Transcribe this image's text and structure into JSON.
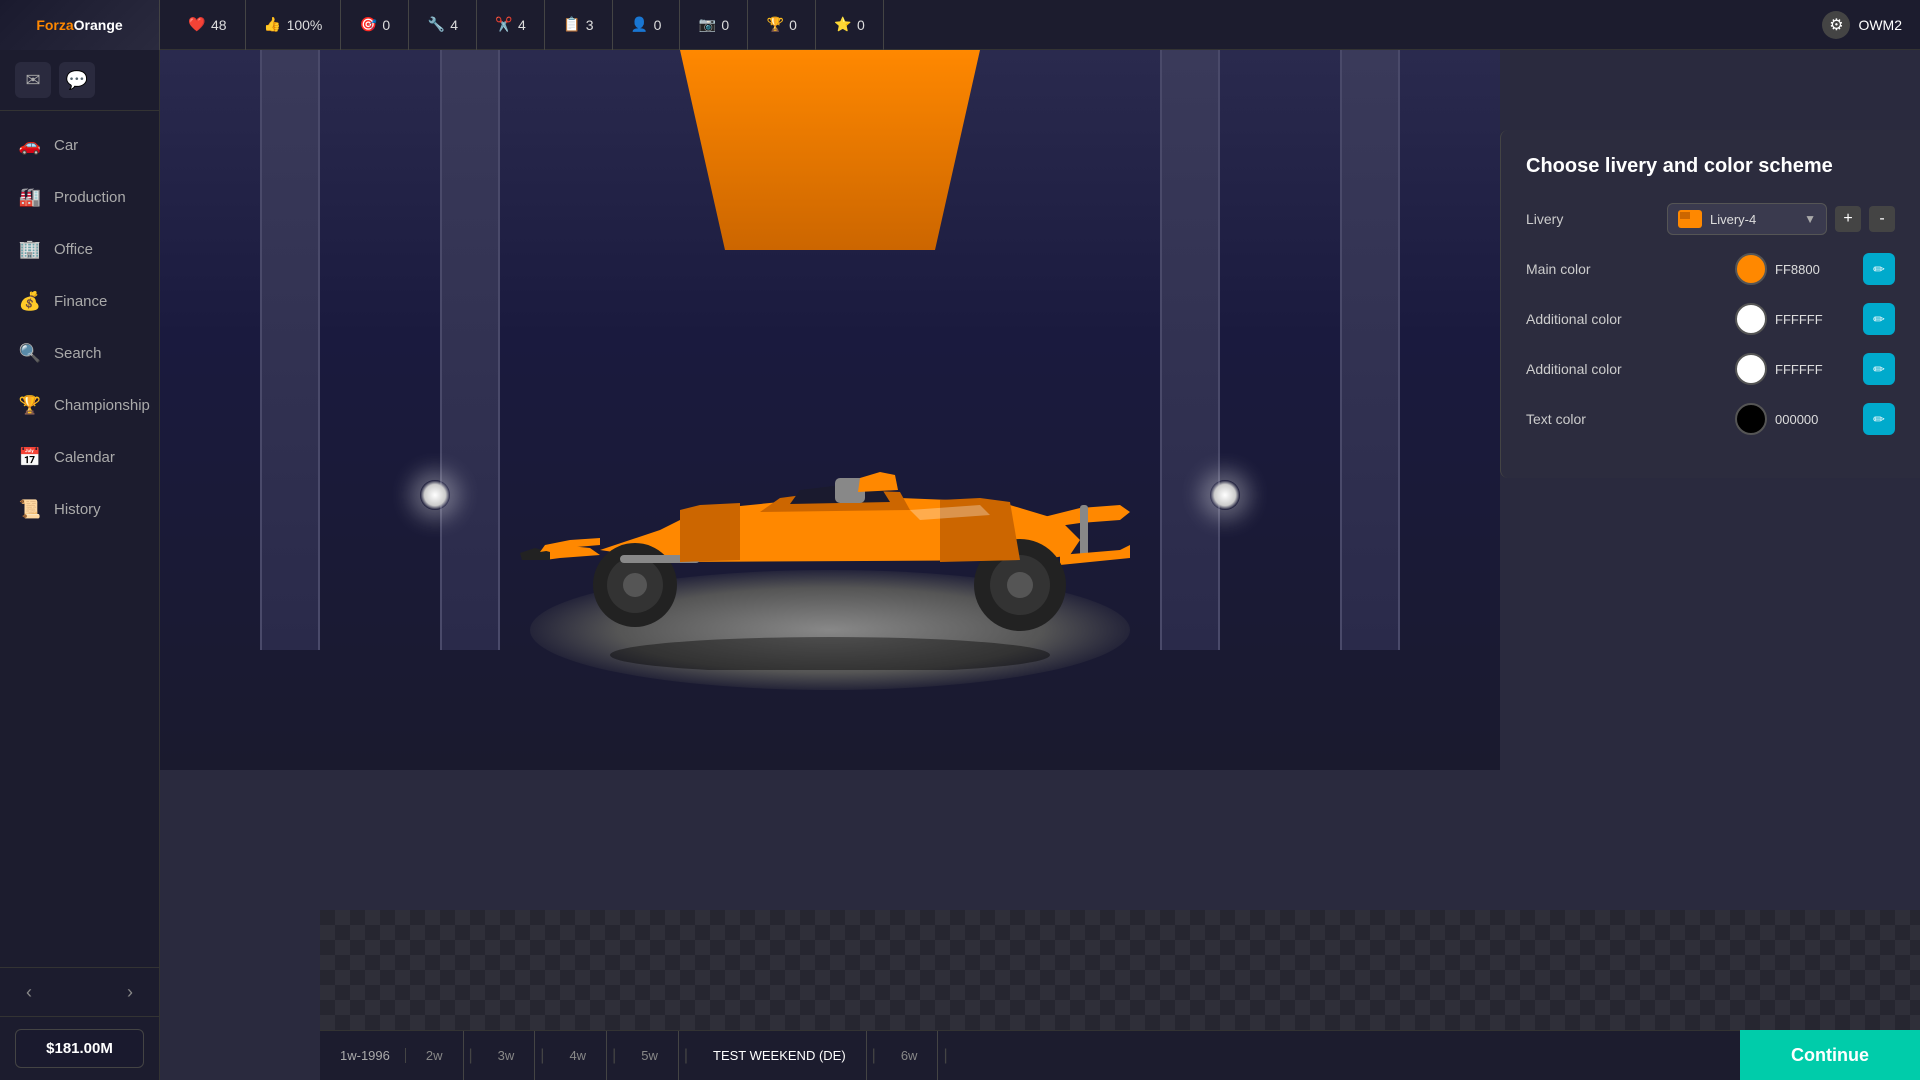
{
  "logo": {
    "part1": "Forza",
    "part2": "Orange"
  },
  "topbar": {
    "stats": [
      {
        "icon": "❤️",
        "iconClass": "red",
        "value": "48",
        "id": "health"
      },
      {
        "icon": "👍",
        "iconClass": "green",
        "value": "100%",
        "id": "approval"
      },
      {
        "icon": "🎯",
        "iconClass": "purple",
        "value": "0",
        "id": "sponsors"
      },
      {
        "icon": "🔧",
        "iconClass": "blue",
        "value": "4",
        "id": "mechanics"
      },
      {
        "icon": "✂️",
        "iconClass": "yellow",
        "value": "4",
        "id": "tools"
      },
      {
        "icon": "📋",
        "iconClass": "teal",
        "value": "3",
        "id": "tasks"
      },
      {
        "icon": "👤",
        "iconClass": "orange",
        "value": "0",
        "id": "staff"
      },
      {
        "icon": "📷",
        "iconClass": "blue",
        "value": "0",
        "id": "media"
      },
      {
        "icon": "🏆",
        "iconClass": "yellow",
        "value": "0",
        "id": "trophy"
      },
      {
        "icon": "⭐",
        "iconClass": "teal",
        "value": "0",
        "id": "stars"
      }
    ],
    "username": "OWM2"
  },
  "sidebar": {
    "notifications": [
      {
        "icon": "✉️",
        "label": "mail-button"
      },
      {
        "icon": "💬",
        "label": "chat-button"
      }
    ],
    "items": [
      {
        "icon": "🚗",
        "label": "Car",
        "id": "car",
        "active": false
      },
      {
        "icon": "🏭",
        "label": "Production",
        "id": "production",
        "active": false
      },
      {
        "icon": "🏢",
        "label": "Office",
        "id": "office",
        "active": false
      },
      {
        "icon": "💰",
        "label": "Finance",
        "id": "finance",
        "active": false
      },
      {
        "icon": "🔍",
        "label": "Search",
        "id": "search",
        "active": false
      },
      {
        "icon": "🏆",
        "label": "Championship",
        "id": "championship",
        "active": false
      },
      {
        "icon": "📅",
        "label": "Calendar",
        "id": "calendar",
        "active": false
      },
      {
        "icon": "📜",
        "label": "History",
        "id": "history",
        "active": false
      }
    ],
    "money": "$181.00M"
  },
  "panel": {
    "title": "Choose livery and color scheme",
    "livery_label": "Livery",
    "livery_value": "Livery-4",
    "colors": [
      {
        "label": "Main color",
        "hex": "FF8800",
        "swatch": "#FF8800"
      },
      {
        "label": "Additional color",
        "hex": "FFFFFF",
        "swatch": "#FFFFFF"
      },
      {
        "label": "Additional color",
        "hex": "FFFFFF",
        "swatch": "#FFFFFF"
      },
      {
        "label": "Text color",
        "hex": "000000",
        "swatch": "#000000"
      }
    ],
    "plus_label": "+",
    "minus_label": "-"
  },
  "bottombar": {
    "time": "1w-1996",
    "weeks": [
      {
        "label": "2w",
        "id": "w2"
      },
      {
        "label": "3w",
        "id": "w3"
      },
      {
        "label": "4w",
        "id": "w4"
      },
      {
        "label": "5w",
        "id": "w5"
      },
      {
        "label": "TEST WEEKEND (DE)",
        "id": "event",
        "highlight": true
      },
      {
        "label": "6w",
        "id": "w6"
      }
    ],
    "continue_label": "Continue"
  }
}
